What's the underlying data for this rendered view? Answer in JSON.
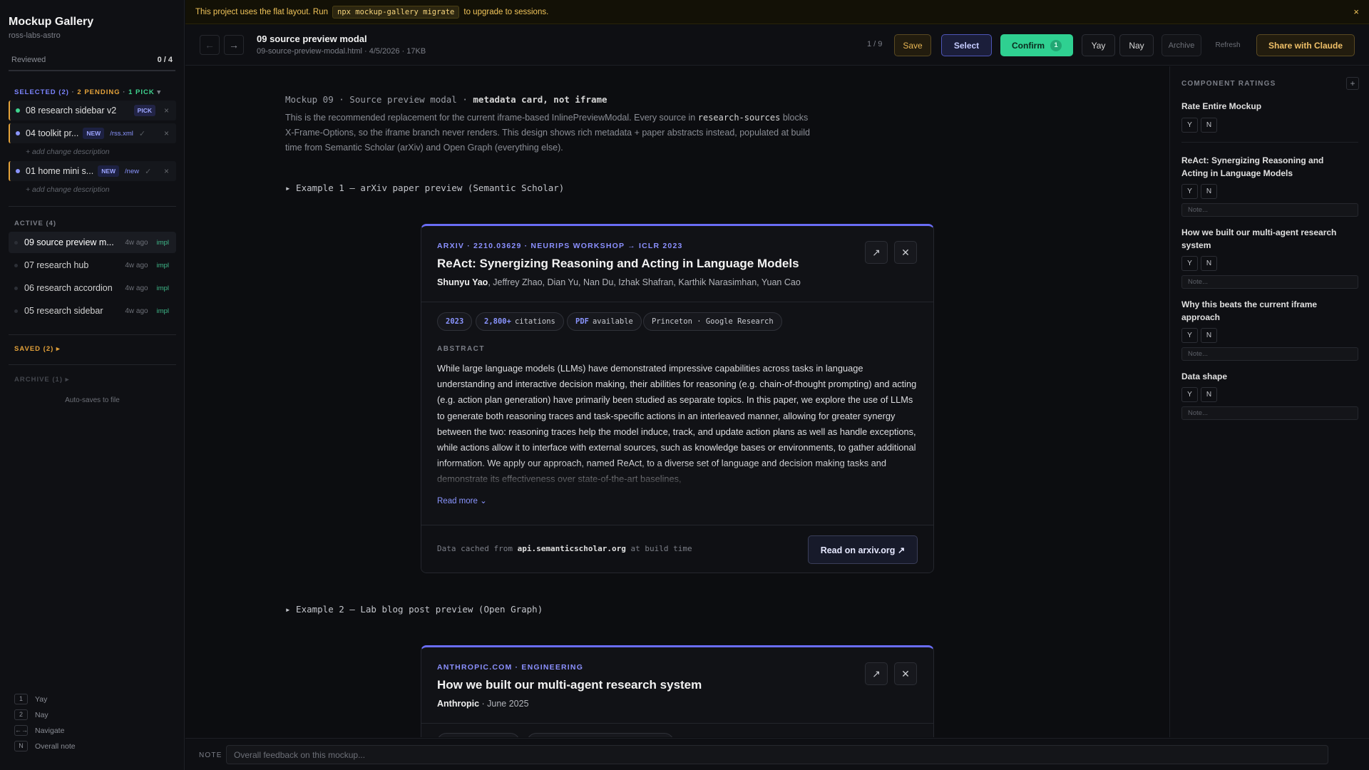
{
  "sidebar": {
    "app_title": "Mockup Gallery",
    "project": "ross-labs-astro",
    "reviewed_label": "Reviewed",
    "reviewed_count": "0 / 4",
    "selected_header": "SELECTED (2)",
    "selected_pending": "2 PENDING",
    "selected_pick": "1 PICK",
    "selected_items": [
      {
        "label": "08 research sidebar v2",
        "badge": "PICK",
        "dot_color": "#3fd48f"
      },
      {
        "label": "04 toolkit pr...",
        "badge": "NEW",
        "route": "/rss.xml",
        "dot_color": "#8a95ff"
      },
      {
        "label": "01 home mini s...",
        "badge": "NEW",
        "route": "/new",
        "dot_color": "#8a95ff"
      }
    ],
    "add_change_description": "+ add change description",
    "active_header": "ACTIVE (4)",
    "active_items": [
      {
        "label": "09 source preview m...",
        "ago": "4w ago",
        "status": "impl"
      },
      {
        "label": "07 research hub",
        "ago": "4w ago",
        "status": "impl"
      },
      {
        "label": "06 research accordion",
        "ago": "4w ago",
        "status": "impl"
      },
      {
        "label": "05 research sidebar",
        "ago": "4w ago",
        "status": "impl"
      }
    ],
    "saved_header": "SAVED (2)",
    "archive_header": "ARCHIVE (1)",
    "autosave_text": "Auto-saves to file",
    "shortcuts": [
      {
        "key": "1",
        "label": "Yay"
      },
      {
        "key": "2",
        "label": "Nay"
      },
      {
        "key": "←→",
        "label": "Navigate"
      },
      {
        "key": "N",
        "label": "Overall note"
      }
    ]
  },
  "banner": {
    "text_before": "This project uses the flat layout. Run",
    "command": "npx mockup-gallery migrate",
    "text_after": "to upgrade to sessions.",
    "close": "×"
  },
  "header": {
    "prev": "←",
    "next": "→",
    "title": "09 source preview modal",
    "meta": "09-source-preview-modal.html · 4/5/2026 · 17KB",
    "position": "1 / 9",
    "save": "Save",
    "select": "Select",
    "confirm": "Confirm",
    "confirm_count": "1",
    "yay": "Yay",
    "nay": "Nay",
    "archive": "Archive",
    "refresh": "Refresh",
    "share": "Share with Claude"
  },
  "main": {
    "intro_prefix": "Mockup 09 · Source preview modal ·",
    "intro_bold": "metadata card, not iframe",
    "intro_text_1": "This is the recommended replacement for the current iframe-based InlinePreviewModal. Every source in",
    "intro_code": "research-sources",
    "intro_text_2": "blocks X-Frame-Options, so the iframe branch never renders. This design shows rich metadata + paper abstracts instead, populated at build time from Semantic Scholar (arXiv) and Open Graph (everything else).",
    "example1_label": "▸ Example 1 — arXiv paper preview (Semantic Scholar)",
    "example2_label": "▸ Example 2 — Lab blog post preview (Open Graph)",
    "card1": {
      "eyebrow": "ARXIV · 2210.03629 · NEURIPS WORKSHOP → ICLR 2023",
      "title": "ReAct: Synergizing Reasoning and Acting in Language Models",
      "lead_author": "Shunyu Yao",
      "other_authors": ", Jeffrey Zhao, Dian Yu, Nan Du, Izhak Shafran, Karthik Narasimhan, Yuan Cao",
      "chip_year": "2023",
      "chip_citations_bold": "2,800+",
      "chip_citations": "citations",
      "chip_pdf_bold": "PDF",
      "chip_pdf": "available",
      "chip_institution": "Princeton · Google Research",
      "abstract_label": "ABSTRACT",
      "abstract": "While large language models (LLMs) have demonstrated impressive capabilities across tasks in language understanding and interactive decision making, their abilities for reasoning (e.g. chain-of-thought prompting) and acting (e.g. action plan generation) have primarily been studied as separate topics. In this paper, we explore the use of LLMs to generate both reasoning traces and task-specific actions in an interleaved manner, allowing for greater synergy between the two: reasoning traces help the model induce, track, and update action plans as well as handle exceptions, while actions allow it to interface with external sources, such as knowledge bases or environments, to gather additional information. We apply our approach, named ReAct, to a diverse set of language and decision making tasks and demonstrate its effectiveness over state-of-the-art baselines,",
      "read_more": "Read more ⌄",
      "foot_prefix": "Data cached from",
      "foot_source": "api.semanticscholar.org",
      "foot_suffix": "at build time",
      "foot_button": "Read on arxiv.org ↗"
    },
    "card2": {
      "eyebrow": "ANTHROPIC.COM · ENGINEERING",
      "title": "How we built our multi-agent research system",
      "author": "Anthropic",
      "date": " · June 2025"
    }
  },
  "ratings": {
    "header": "COMPONENT RATINGS",
    "plus": "+",
    "entire": "Rate Entire Mockup",
    "y": "Y",
    "n": "N",
    "note_placeholder": "Note...",
    "items": [
      "ReAct: Synergizing Reasoning and Acting in Language Models",
      "How we built our multi-agent research system",
      "Why this beats the current iframe approach",
      "Data shape"
    ]
  },
  "notebar": {
    "label": "NOTE",
    "placeholder": "Overall feedback on this mockup..."
  }
}
